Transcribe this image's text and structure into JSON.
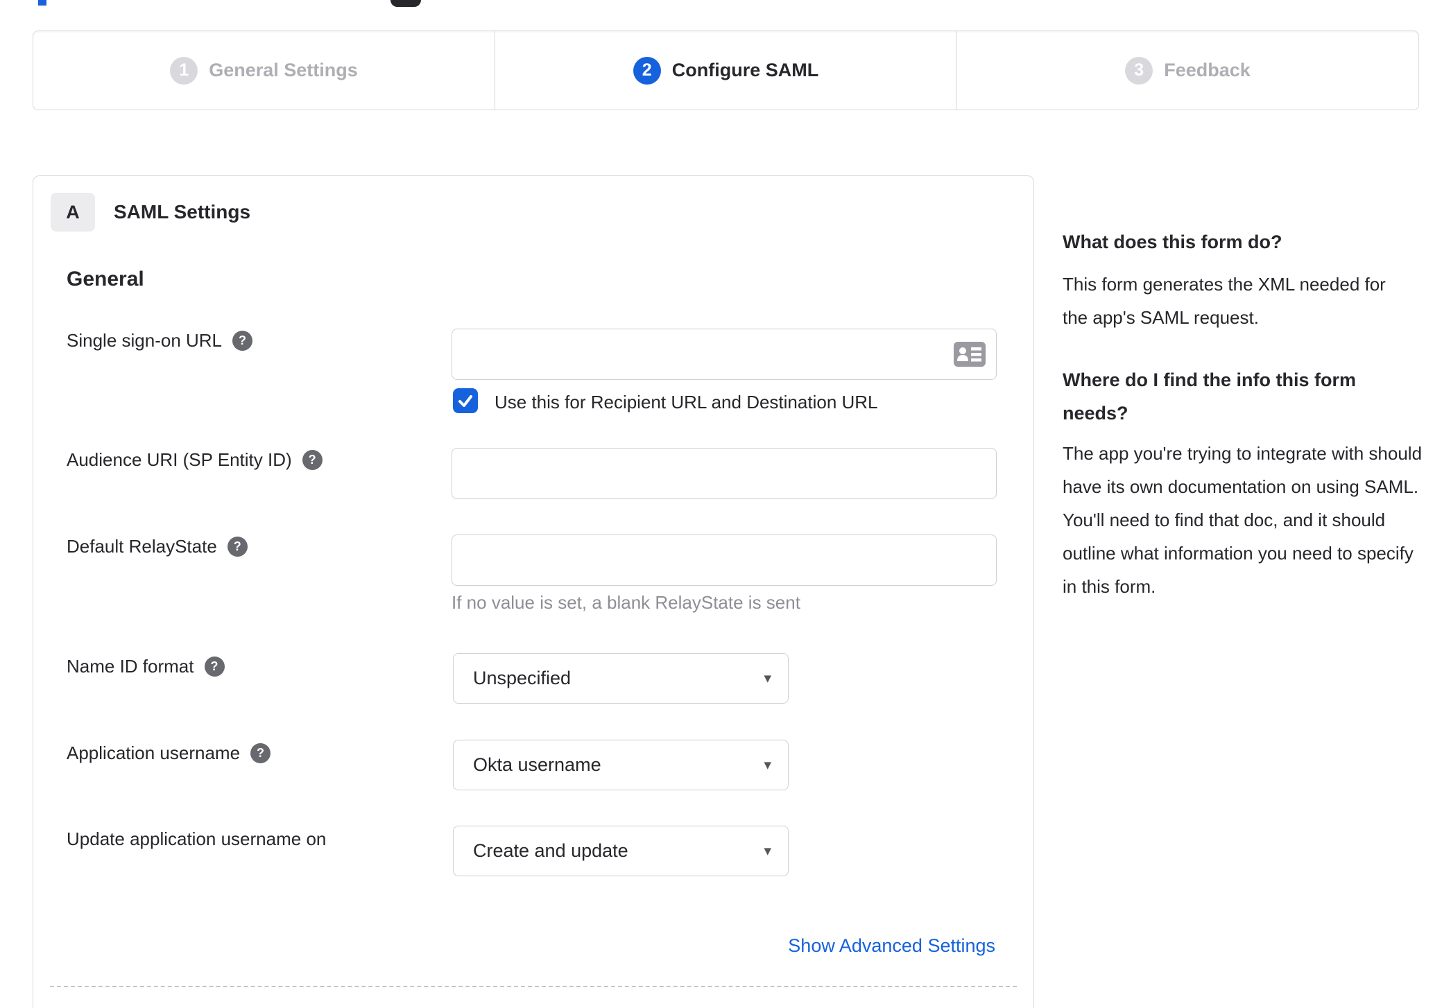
{
  "stepper": {
    "steps": [
      {
        "number": "1",
        "label": "General Settings",
        "state": "inactive"
      },
      {
        "number": "2",
        "label": "Configure SAML",
        "state": "active"
      },
      {
        "number": "3",
        "label": "Feedback",
        "state": "inactive"
      }
    ]
  },
  "panel": {
    "section_badge": "A",
    "section_title": "SAML Settings",
    "group_heading": "General",
    "fields": {
      "sso_url": {
        "label": "Single sign-on URL",
        "value": "",
        "has_help": true
      },
      "sso_checkbox": {
        "label": "Use this for Recipient URL and Destination URL",
        "checked": true
      },
      "audience_uri": {
        "label": "Audience URI (SP Entity ID)",
        "value": "",
        "has_help": true
      },
      "relay_state": {
        "label": "Default RelayState",
        "value": "",
        "has_help": true,
        "hint": "If no value is set, a blank RelayState is sent"
      },
      "name_id_format": {
        "label": "Name ID format",
        "value": "Unspecified",
        "has_help": true
      },
      "app_username": {
        "label": "Application username",
        "value": "Okta username",
        "has_help": true
      },
      "update_app_username": {
        "label": "Update application username on",
        "value": "Create and update",
        "has_help": false
      }
    },
    "advanced_link": "Show Advanced Settings"
  },
  "sidebar": {
    "section1": {
      "heading": "What does this form do?",
      "body": "This form generates the XML needed for the app's SAML request."
    },
    "section2": {
      "heading": "Where do I find the info this form needs?",
      "body": "The app you're trying to integrate with should have its own documentation on using SAML. You'll need to find that doc, and it should outline what information you need to specify in this form."
    }
  },
  "icons": {
    "help": "?",
    "dropdown_arrow": "▾"
  },
  "colors": {
    "accent_blue": "#1662dd",
    "inactive_gray": "#aeaeb4",
    "circle_gray": "#d9d9dd",
    "border_gray": "#d9d9dd",
    "hint_gray": "#8e8e96",
    "text_dark": "#26262b"
  }
}
